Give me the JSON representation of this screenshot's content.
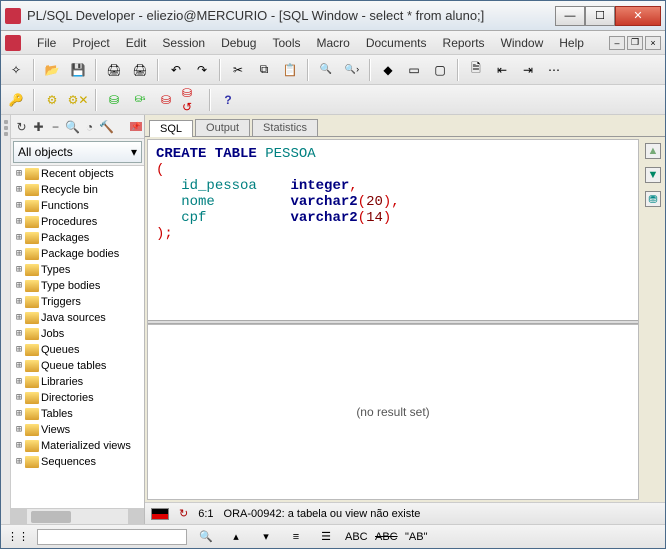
{
  "window": {
    "title": "PL/SQL Developer - eliezio@MERCURIO - [SQL Window - select * from aluno;]"
  },
  "menu": [
    "File",
    "Project",
    "Edit",
    "Session",
    "Debug",
    "Tools",
    "Macro",
    "Documents",
    "Reports",
    "Window",
    "Help"
  ],
  "sidebar": {
    "filter": "All objects",
    "items": [
      "Recent objects",
      "Recycle bin",
      "Functions",
      "Procedures",
      "Packages",
      "Package bodies",
      "Types",
      "Type bodies",
      "Triggers",
      "Java sources",
      "Jobs",
      "Queues",
      "Queue tables",
      "Libraries",
      "Directories",
      "Tables",
      "Views",
      "Materialized views",
      "Sequences"
    ]
  },
  "tabs": [
    "SQL",
    "Output",
    "Statistics"
  ],
  "activeTab": 0,
  "code": {
    "create": "CREATE TABLE",
    "table_name": "PESSOA",
    "cols": [
      {
        "name": "id_pessoa",
        "type": "integer",
        "size": ""
      },
      {
        "name": "nome",
        "type": "varchar2",
        "size": "(20)"
      },
      {
        "name": "cpf",
        "type": "varchar2",
        "size": "(14)"
      }
    ]
  },
  "results": {
    "empty": "(no result set)"
  },
  "status": {
    "pos": "6:1",
    "msg": "ORA-00942: a tabela ou view não existe"
  },
  "searchbar": {
    "abc": "ABC",
    "ab": "\"AB\""
  }
}
